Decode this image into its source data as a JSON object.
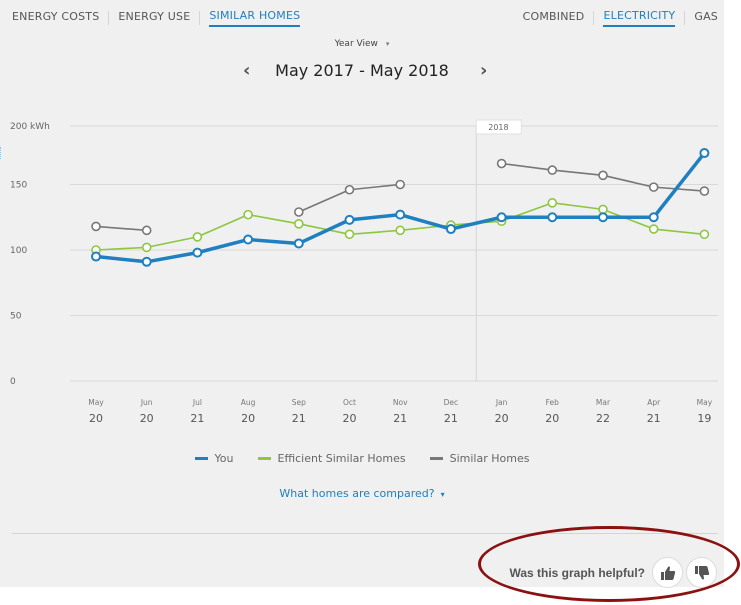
{
  "header": {
    "left_tabs": [
      {
        "label": "ENERGY COSTS",
        "active": false
      },
      {
        "label": "ENERGY USE",
        "active": false
      },
      {
        "label": "SIMILAR HOMES",
        "active": true
      }
    ],
    "right_tabs": [
      {
        "label": "COMBINED",
        "active": false
      },
      {
        "label": "ELECTRICITY",
        "active": true
      },
      {
        "label": "GAS",
        "active": false
      }
    ]
  },
  "view": {
    "selector_label": "Year View",
    "selector_caret": "▾",
    "range_label": "May 2017 - May 2018",
    "prev_icon": "‹",
    "next_icon": "›"
  },
  "legend": {
    "items": [
      {
        "label": "You",
        "color": "#1e7fc1"
      },
      {
        "label": "Efficient Similar Homes",
        "color": "#8dc63f"
      },
      {
        "label": "Similar Homes",
        "color": "#777777"
      }
    ]
  },
  "compare_link": {
    "label": "What homes are compared?",
    "caret": "▾"
  },
  "feedback": {
    "question": "Was this graph helpful?",
    "thumbs_up": "thumbs-up",
    "thumbs_down": "thumbs-down"
  },
  "colors": {
    "accent": "#1e7fc1",
    "annotation": "#8b1111"
  },
  "chart_data": {
    "type": "line",
    "title": "",
    "xlabel": "",
    "ylabel": "kWh",
    "ylim": [
      0,
      200
    ],
    "yticks": [
      {
        "value": 0,
        "label": "0"
      },
      {
        "value": 50,
        "label": "50"
      },
      {
        "value": 100,
        "label": "100"
      },
      {
        "value": 150,
        "label": "150"
      },
      {
        "value": 200,
        "label": "200 kWh"
      }
    ],
    "grid": true,
    "year_marker": {
      "label": "2018",
      "between": [
        "Dec",
        "Jan"
      ]
    },
    "categories": [
      {
        "month": "May",
        "day": "20"
      },
      {
        "month": "Jun",
        "day": "20"
      },
      {
        "month": "Jul",
        "day": "21"
      },
      {
        "month": "Aug",
        "day": "20"
      },
      {
        "month": "Sep",
        "day": "21"
      },
      {
        "month": "Oct",
        "day": "20"
      },
      {
        "month": "Nov",
        "day": "21"
      },
      {
        "month": "Dec",
        "day": "21"
      },
      {
        "month": "Jan",
        "day": "20"
      },
      {
        "month": "Feb",
        "day": "20"
      },
      {
        "month": "Mar",
        "day": "22"
      },
      {
        "month": "Apr",
        "day": "21"
      },
      {
        "month": "May",
        "day": "19"
      }
    ],
    "series": [
      {
        "name": "Similar Homes",
        "color": "#777777",
        "width": "thin",
        "values": [
          118,
          115,
          null,
          null,
          129,
          146,
          150,
          null,
          166,
          161,
          157,
          148,
          145
        ]
      },
      {
        "name": "Efficient Similar Homes",
        "color": "#8dc63f",
        "width": "thin",
        "values": [
          100,
          102,
          110,
          127,
          120,
          112,
          115,
          119,
          122,
          136,
          131,
          116,
          112
        ]
      },
      {
        "name": "You",
        "color": "#1e7fc1",
        "width": "thick",
        "values": [
          95,
          91,
          98,
          108,
          105,
          123,
          127,
          116,
          125,
          125,
          125,
          125,
          174
        ]
      }
    ],
    "legend_position": "bottom"
  }
}
